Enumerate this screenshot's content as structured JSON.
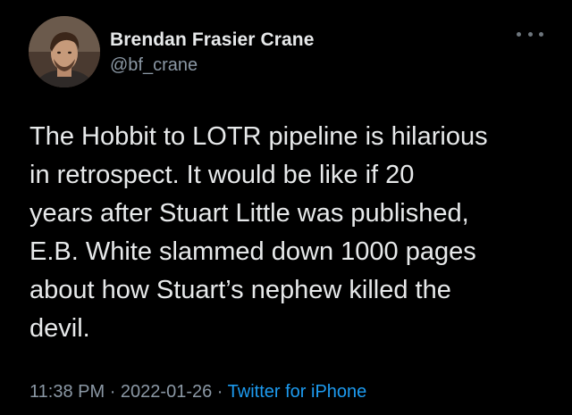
{
  "author": {
    "display_name": "Brendan Frasier Crane",
    "handle": "@bf_crane",
    "avatar_icon": "profile-photo"
  },
  "tweet": {
    "text": "The Hobbit to LOTR pipeline is hilarious\nin retrospect. It would be like if 20\nyears after Stuart Little was published,\nE.B. White slammed down 1000 pages\nabout how Stuart’s nephew killed the\ndevil.",
    "time": "11:38 PM",
    "separator": "·",
    "date": "2022-01-26",
    "source": "Twitter for iPhone"
  },
  "menu": {
    "icon": "more-icon"
  },
  "colors": {
    "background": "#000000",
    "primary_text": "#e7e9ea",
    "secondary_text": "#8b98a5",
    "link": "#1d9bf0"
  }
}
